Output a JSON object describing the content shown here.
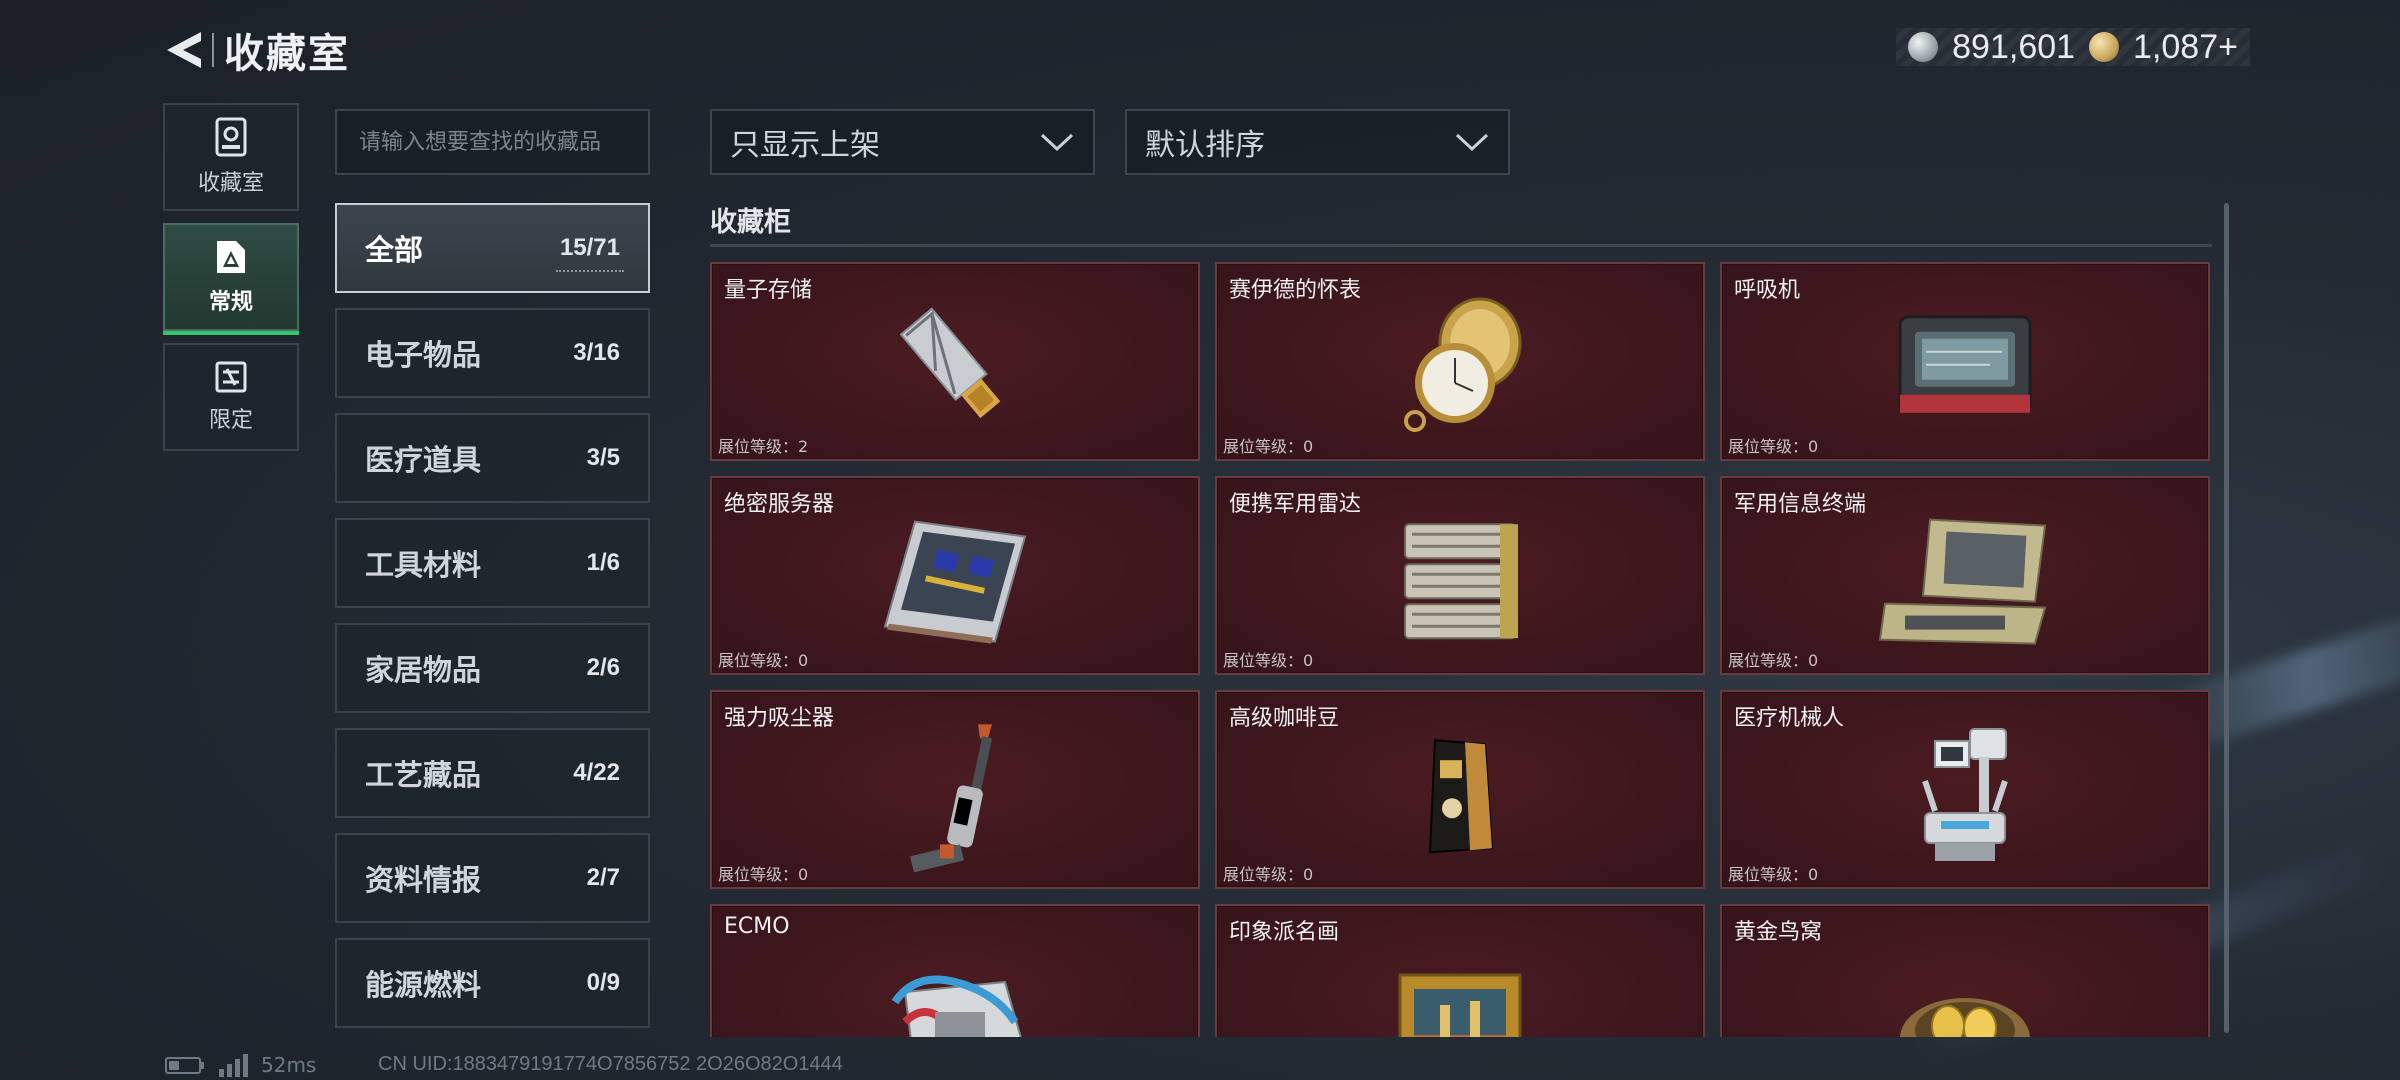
{
  "header": {
    "title": "收藏室",
    "currency": [
      {
        "icon": "silver-coin-icon",
        "value": "891,601"
      },
      {
        "icon": "gold-coin-icon",
        "value": "1,087+"
      }
    ]
  },
  "rail": [
    {
      "label": "收藏室",
      "icon": "collection-room-icon",
      "active": false
    },
    {
      "label": "常规",
      "icon": "regular-icon",
      "active": true
    },
    {
      "label": "限定",
      "icon": "limited-icon",
      "active": false
    }
  ],
  "search": {
    "placeholder": "请输入想要查找的收藏品"
  },
  "categories": [
    {
      "label": "全部",
      "count": "15/71",
      "active": true
    },
    {
      "label": "电子物品",
      "count": "3/16"
    },
    {
      "label": "医疗道具",
      "count": "3/5"
    },
    {
      "label": "工具材料",
      "count": "1/6"
    },
    {
      "label": "家居物品",
      "count": "2/6"
    },
    {
      "label": "工艺藏品",
      "count": "4/22"
    },
    {
      "label": "资料情报",
      "count": "2/7"
    },
    {
      "label": "能源燃料",
      "count": "0/9"
    }
  ],
  "filters": {
    "display": "只显示上架",
    "sort": "默认排序"
  },
  "cabinet": {
    "title": "收藏柜",
    "items": [
      {
        "name": "量子存储",
        "level": "展位等级：2",
        "icon": "usb-drive-icon"
      },
      {
        "name": "赛伊德的怀表",
        "level": "展位等级：0",
        "icon": "pocket-watch-icon"
      },
      {
        "name": "呼吸机",
        "level": "展位等级：0",
        "icon": "ventilator-icon"
      },
      {
        "name": "绝密服务器",
        "level": "展位等级：0",
        "icon": "server-icon"
      },
      {
        "name": "便携军用雷达",
        "level": "展位等级：0",
        "icon": "radar-icon"
      },
      {
        "name": "军用信息终端",
        "level": "展位等级：0",
        "icon": "terminal-case-icon"
      },
      {
        "name": "强力吸尘器",
        "level": "展位等级：0",
        "icon": "vacuum-icon"
      },
      {
        "name": "高级咖啡豆",
        "level": "展位等级：0",
        "icon": "coffee-bag-icon"
      },
      {
        "name": "医疗机械人",
        "level": "展位等级：0",
        "icon": "medical-robot-icon"
      },
      {
        "name": "ECMO",
        "level": "",
        "icon": "ecmo-machine-icon"
      },
      {
        "name": "印象派名画",
        "level": "",
        "icon": "framed-painting-icon"
      },
      {
        "name": "黄金鸟窝",
        "level": "",
        "icon": "golden-nest-icon"
      }
    ]
  },
  "status": {
    "ping": "52ms",
    "uid": "CN UID:1883479191774O7856752 2O26O82O1444"
  }
}
